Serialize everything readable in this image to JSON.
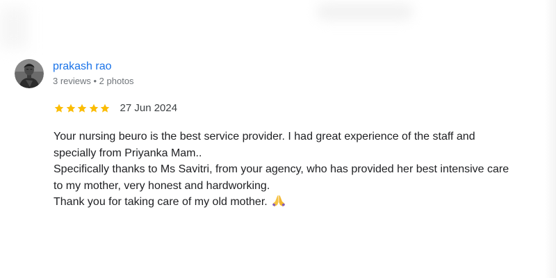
{
  "review": {
    "author": {
      "name": "prakash rao",
      "meta": "3 reviews • 2 photos",
      "avatar_icon": "user-photo-avatar"
    },
    "rating": {
      "stars": 5,
      "max_stars": 5,
      "star_color": "#fbbc04"
    },
    "date": "27 Jun 2024",
    "text_lines": [
      "Your nursing beuro is the best service provider. I had great experience of the staff and",
      "specially from Priyanka Mam..",
      "Specifically thanks to Ms Savitri, from your agency, who has provided her best intensive care",
      "to my mother, very honest and hardworking.",
      "Thank you for taking care of my old mother."
    ],
    "emoji_icon": "folded-hands-icon"
  },
  "colors": {
    "author_name": "#1a73e8",
    "meta": "#70757a",
    "body_text": "#202124"
  }
}
